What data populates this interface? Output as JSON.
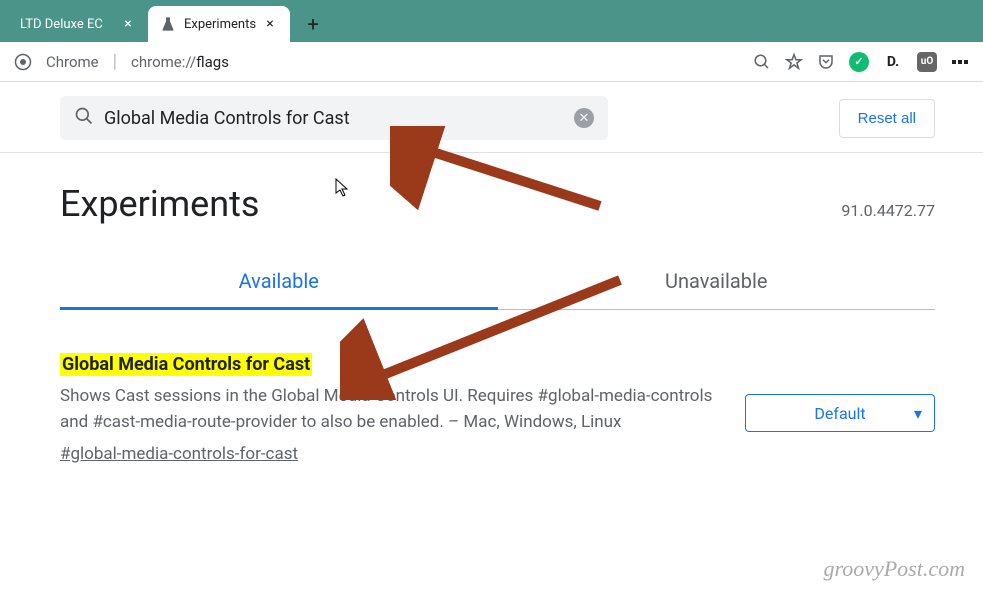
{
  "tabs": [
    {
      "title": "LTD Deluxe EC",
      "active": false
    },
    {
      "title": "Experiments",
      "active": true
    }
  ],
  "address": {
    "scheme_label": "Chrome",
    "url_prefix": "chrome://",
    "url_bold": "flags"
  },
  "search": {
    "value": "Global Media Controls for Cast"
  },
  "buttons": {
    "reset_all": "Reset all"
  },
  "page": {
    "title": "Experiments",
    "version": "91.0.4472.77"
  },
  "tab_row": {
    "available": "Available",
    "unavailable": "Unavailable"
  },
  "flag": {
    "title": "Global Media Controls for Cast",
    "description": "Shows Cast sessions in the Global Media Controls UI. Requires #global-media-controls and #cast-media-route-provider to also be enabled. – Mac, Windows, Linux",
    "anchor": "#global-media-controls-for-cast",
    "selected": "Default"
  },
  "watermark": "groovyPost.com",
  "colors": {
    "accent": "#1a73e8",
    "tabbar": "#4a9489",
    "arrow": "#9b3a1a",
    "highlight": "#ffff00"
  }
}
